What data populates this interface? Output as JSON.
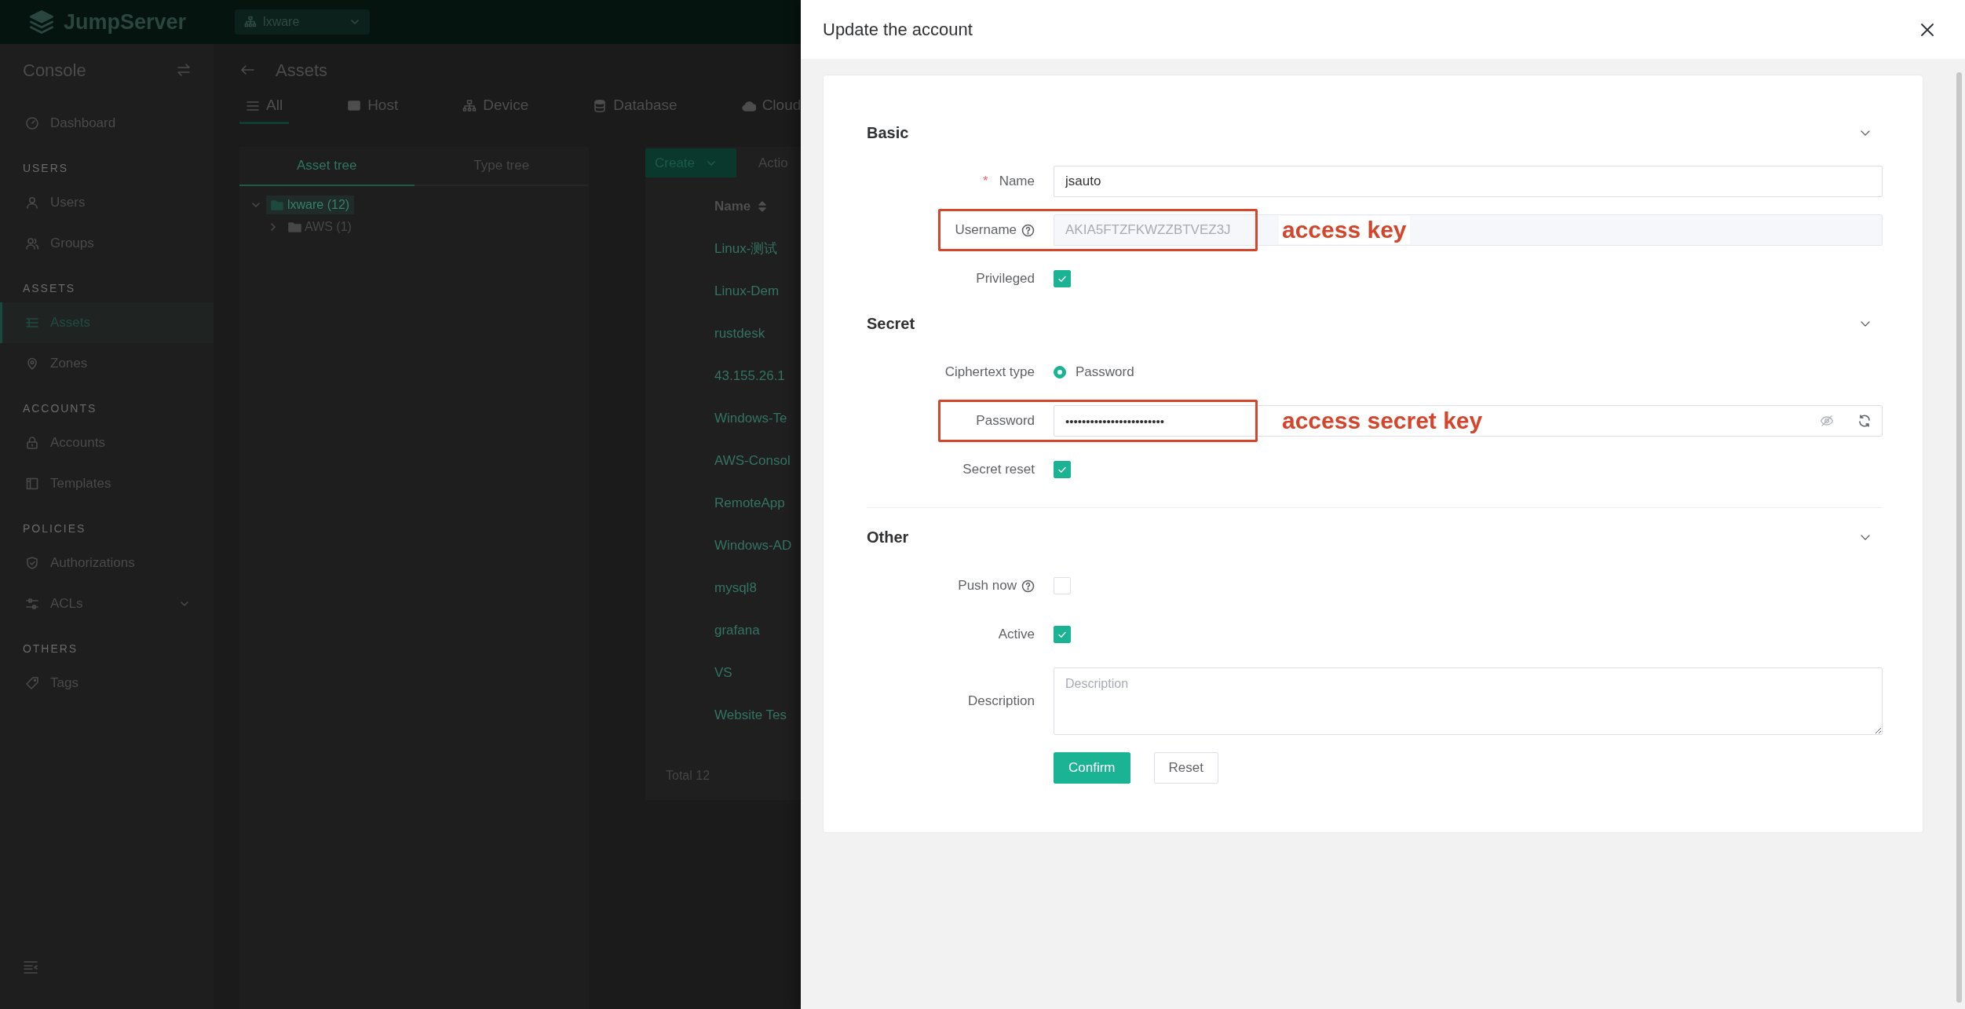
{
  "app": {
    "brand": "JumpServer",
    "org": "lxware",
    "sidebar": {
      "title": "Console",
      "sections": [
        {
          "items": [
            {
              "label": "Dashboard",
              "kind": "link",
              "selected": false
            }
          ]
        },
        {
          "heading": "USERS",
          "items": [
            {
              "label": "Users",
              "kind": "link",
              "selected": false
            },
            {
              "label": "Groups",
              "kind": "link",
              "selected": false
            }
          ]
        },
        {
          "heading": "ASSETS",
          "items": [
            {
              "label": "Assets",
              "kind": "link",
              "selected": true
            },
            {
              "label": "Zones",
              "kind": "link",
              "selected": false
            }
          ]
        },
        {
          "heading": "ACCOUNTS",
          "items": [
            {
              "label": "Accounts",
              "kind": "link",
              "selected": false
            },
            {
              "label": "Templates",
              "kind": "link",
              "selected": false
            }
          ]
        },
        {
          "heading": "POLICIES",
          "items": [
            {
              "label": "Authorizations",
              "kind": "link",
              "selected": false
            },
            {
              "label": "ACLs",
              "kind": "group",
              "selected": false
            }
          ]
        },
        {
          "heading": "OTHERS",
          "items": [
            {
              "label": "Tags",
              "kind": "link",
              "selected": false
            }
          ]
        }
      ]
    },
    "page": {
      "title": "Assets",
      "tabs": [
        {
          "label": "All",
          "selected": true
        },
        {
          "label": "Host",
          "selected": false
        },
        {
          "label": "Device",
          "selected": false
        },
        {
          "label": "Database",
          "selected": false
        },
        {
          "label": "Cloud",
          "selected": false
        }
      ],
      "tree_tabs": [
        {
          "label": "Asset tree",
          "selected": true
        },
        {
          "label": "Type tree",
          "selected": false
        }
      ],
      "tree": [
        {
          "label": "lxware (12)",
          "expanded": true,
          "selected": true,
          "children": [
            {
              "label": "AWS (1)",
              "expanded": false,
              "selected": false
            }
          ]
        }
      ],
      "toolbar": {
        "create": "Create",
        "actions": "Actio"
      },
      "table": {
        "columns": [
          "Name"
        ],
        "rows": [
          "Linux-测试",
          "Linux-Dem",
          "rustdesk",
          "43.155.26.1",
          "Windows-Te",
          "AWS-Consol",
          "RemoteApp",
          "Windows-AD",
          "mysql8",
          "grafana",
          "VS",
          "Website Tes"
        ]
      },
      "total": "Total 12"
    }
  },
  "drawer": {
    "title": "Update the account",
    "sections": [
      {
        "title": "Basic",
        "expanded": true,
        "fields": [
          {
            "kind": "text",
            "label": "Name",
            "required_mark": "*",
            "disabled": false,
            "value": "jsauto"
          },
          {
            "kind": "text",
            "label": "Username",
            "help": true,
            "disabled": true,
            "value": "AKIA5FTZFKWZZBTVEZ3J",
            "annotation": "access key"
          },
          {
            "kind": "checkbox",
            "label": "Privileged",
            "checked": true
          }
        ]
      },
      {
        "title": "Secret",
        "expanded": true,
        "fields": [
          {
            "kind": "radio",
            "label": "Ciphertext type",
            "options": [
              {
                "label": "Password",
                "selected": true
              }
            ]
          },
          {
            "kind": "password",
            "label": "Password",
            "value": "••••••••••••••••••••••••",
            "annotation": "access secret key"
          },
          {
            "kind": "checkbox",
            "label": "Secret reset",
            "checked": true
          }
        ]
      },
      {
        "title": "Other",
        "expanded": true,
        "fields": [
          {
            "kind": "checkbox",
            "label": "Push now",
            "help": true,
            "checked": false
          },
          {
            "kind": "checkbox",
            "label": "Active",
            "checked": true
          },
          {
            "kind": "textarea",
            "label": "Description",
            "placeholder": "Description"
          }
        ]
      }
    ],
    "buttons": [
      {
        "label": "Confirm",
        "kind": "primary"
      },
      {
        "label": "Reset",
        "kind": "default"
      }
    ]
  }
}
